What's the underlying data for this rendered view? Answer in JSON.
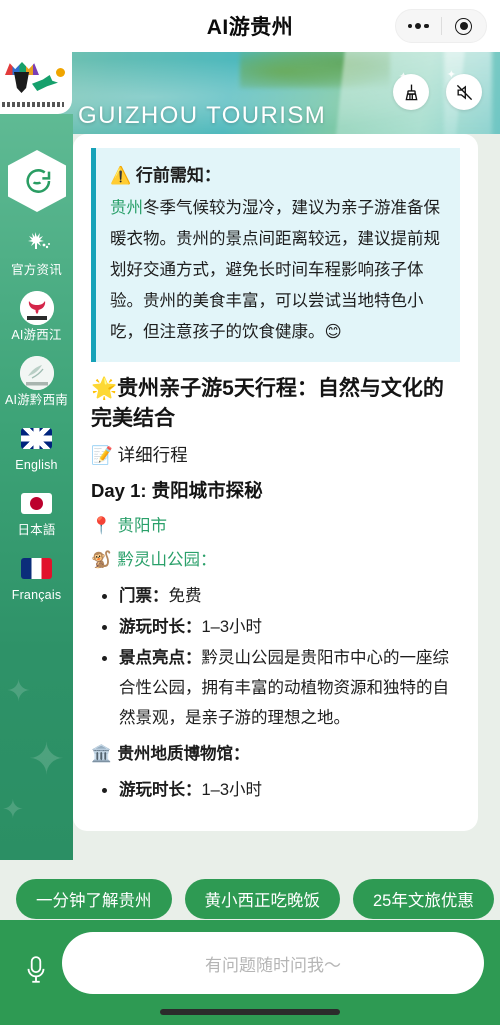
{
  "navbar": {
    "title": "AI游贵州",
    "more_icon": "more-dots-icon",
    "close_icon": "target-circle-icon"
  },
  "banner": {
    "title": "GUIZHOU TOURISM",
    "clear_icon": "broom-icon",
    "mute_icon": "speaker-muted-icon",
    "logo_name": "guizhou-tourism-logo"
  },
  "sidebar": {
    "chat_icon": "chat-bubble-icon",
    "items": [
      {
        "label": "官方资讯",
        "icon": "official-news-icon"
      },
      {
        "label": "AI游西江",
        "icon": "xijiang-icon"
      },
      {
        "label": "AI游黔西南",
        "icon": "qianxinan-icon"
      },
      {
        "label": "English",
        "icon": "uk-flag-icon"
      },
      {
        "label": "日本語",
        "icon": "japan-flag-icon"
      },
      {
        "label": "Français",
        "icon": "france-flag-icon"
      }
    ]
  },
  "message": {
    "notice": {
      "title": "⚠️ 行前需知：",
      "link_text": "贵州",
      "body_rest": "冬季气候较为湿冷，建议为亲子游准备保暖衣物。贵州的景点间距离较远，建议提前规划好交通方式，避免长时间车程影响孩子体验。贵州的美食丰富，可以尝试当地特色小吃，但注意孩子的饮食健康。😊"
    },
    "heading": "🌟贵州亲子游5天行程：自然与文化的完美结合",
    "subheading": "📝 详细行程",
    "day_title": "Day 1: 贵阳城市探秘",
    "city_line": "贵阳市",
    "city_emoji": "📍",
    "poi_title": "黔灵山公园：",
    "poi_emoji": "🐒",
    "bullets": [
      {
        "label": "门票：",
        "value": "免费"
      },
      {
        "label": "游玩时长：",
        "value": "1–3小时"
      },
      {
        "label": "景点亮点：",
        "value": "黔灵山公园是贵阳市中心的一座综合性公园，拥有丰富的动植物资源和独特的自然景观，是亲子游的理想之地。"
      }
    ],
    "next_poi": "贵州地质博物馆：",
    "next_poi_emoji": "🏛️"
  },
  "chips": [
    {
      "label": "一分钟了解贵州"
    },
    {
      "label": "黄小西正吃晚饭"
    },
    {
      "label": "25年文旅优惠"
    },
    {
      "label": ""
    }
  ],
  "input_bar": {
    "placeholder": "有问题随时问我～",
    "mic_icon": "microphone-icon"
  },
  "colors": {
    "brand_green": "#2e9a53",
    "sidebar_green": "#3da377",
    "notice_bg": "#e2f5f9",
    "notice_border": "#17a2b8",
    "link_green": "#2aa06a",
    "page_bg": "#e9efe9"
  }
}
